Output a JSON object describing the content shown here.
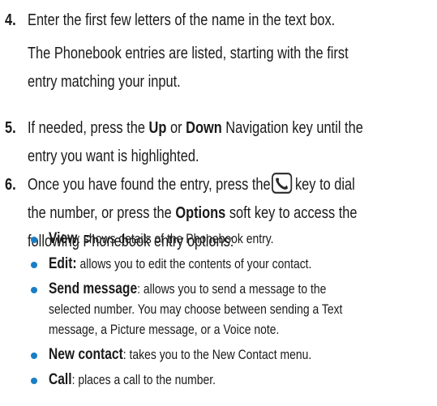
{
  "step4": {
    "number": "4.",
    "line1": "Enter the first few letters of the name in the text box.",
    "para_line1": "The Phonebook entries are listed, starting with the first",
    "para_line2": "entry matching your input."
  },
  "step5": {
    "number": "5.",
    "pre": "If needed, press the ",
    "up": "Up",
    "mid": " or ",
    "down": "Down",
    "post": " Navigation key until the",
    "line2": "entry you want is highlighted."
  },
  "step6": {
    "number": "6.",
    "pre": "Once you have found the entry, press the",
    "post": "key to dial",
    "icon": "send-call-key-icon",
    "line2_pre": "the number, or press the ",
    "options": "Options",
    "line2_post": " soft key to access the",
    "line3": "following Phonebook entry options:"
  },
  "options": [
    {
      "term": "View",
      "text": ": shows details of the Phonebook entry.",
      "lines": []
    },
    {
      "term": "Edit:",
      "text": " allows you to edit the contents of your contact.",
      "lines": []
    },
    {
      "term": "Send message",
      "text": ": allows you to send a message to the",
      "lines": [
        "selected number. You may choose between sending a Text",
        "message, a Picture message, or a Voice note."
      ]
    },
    {
      "term": "New contact",
      "text": ": takes you to the New Contact menu.",
      "lines": []
    },
    {
      "term": "Call",
      "text": ": places a call to the number.",
      "lines": []
    }
  ],
  "colors": {
    "bullet": "#1a7ec5",
    "text": "#1a1a1a"
  }
}
